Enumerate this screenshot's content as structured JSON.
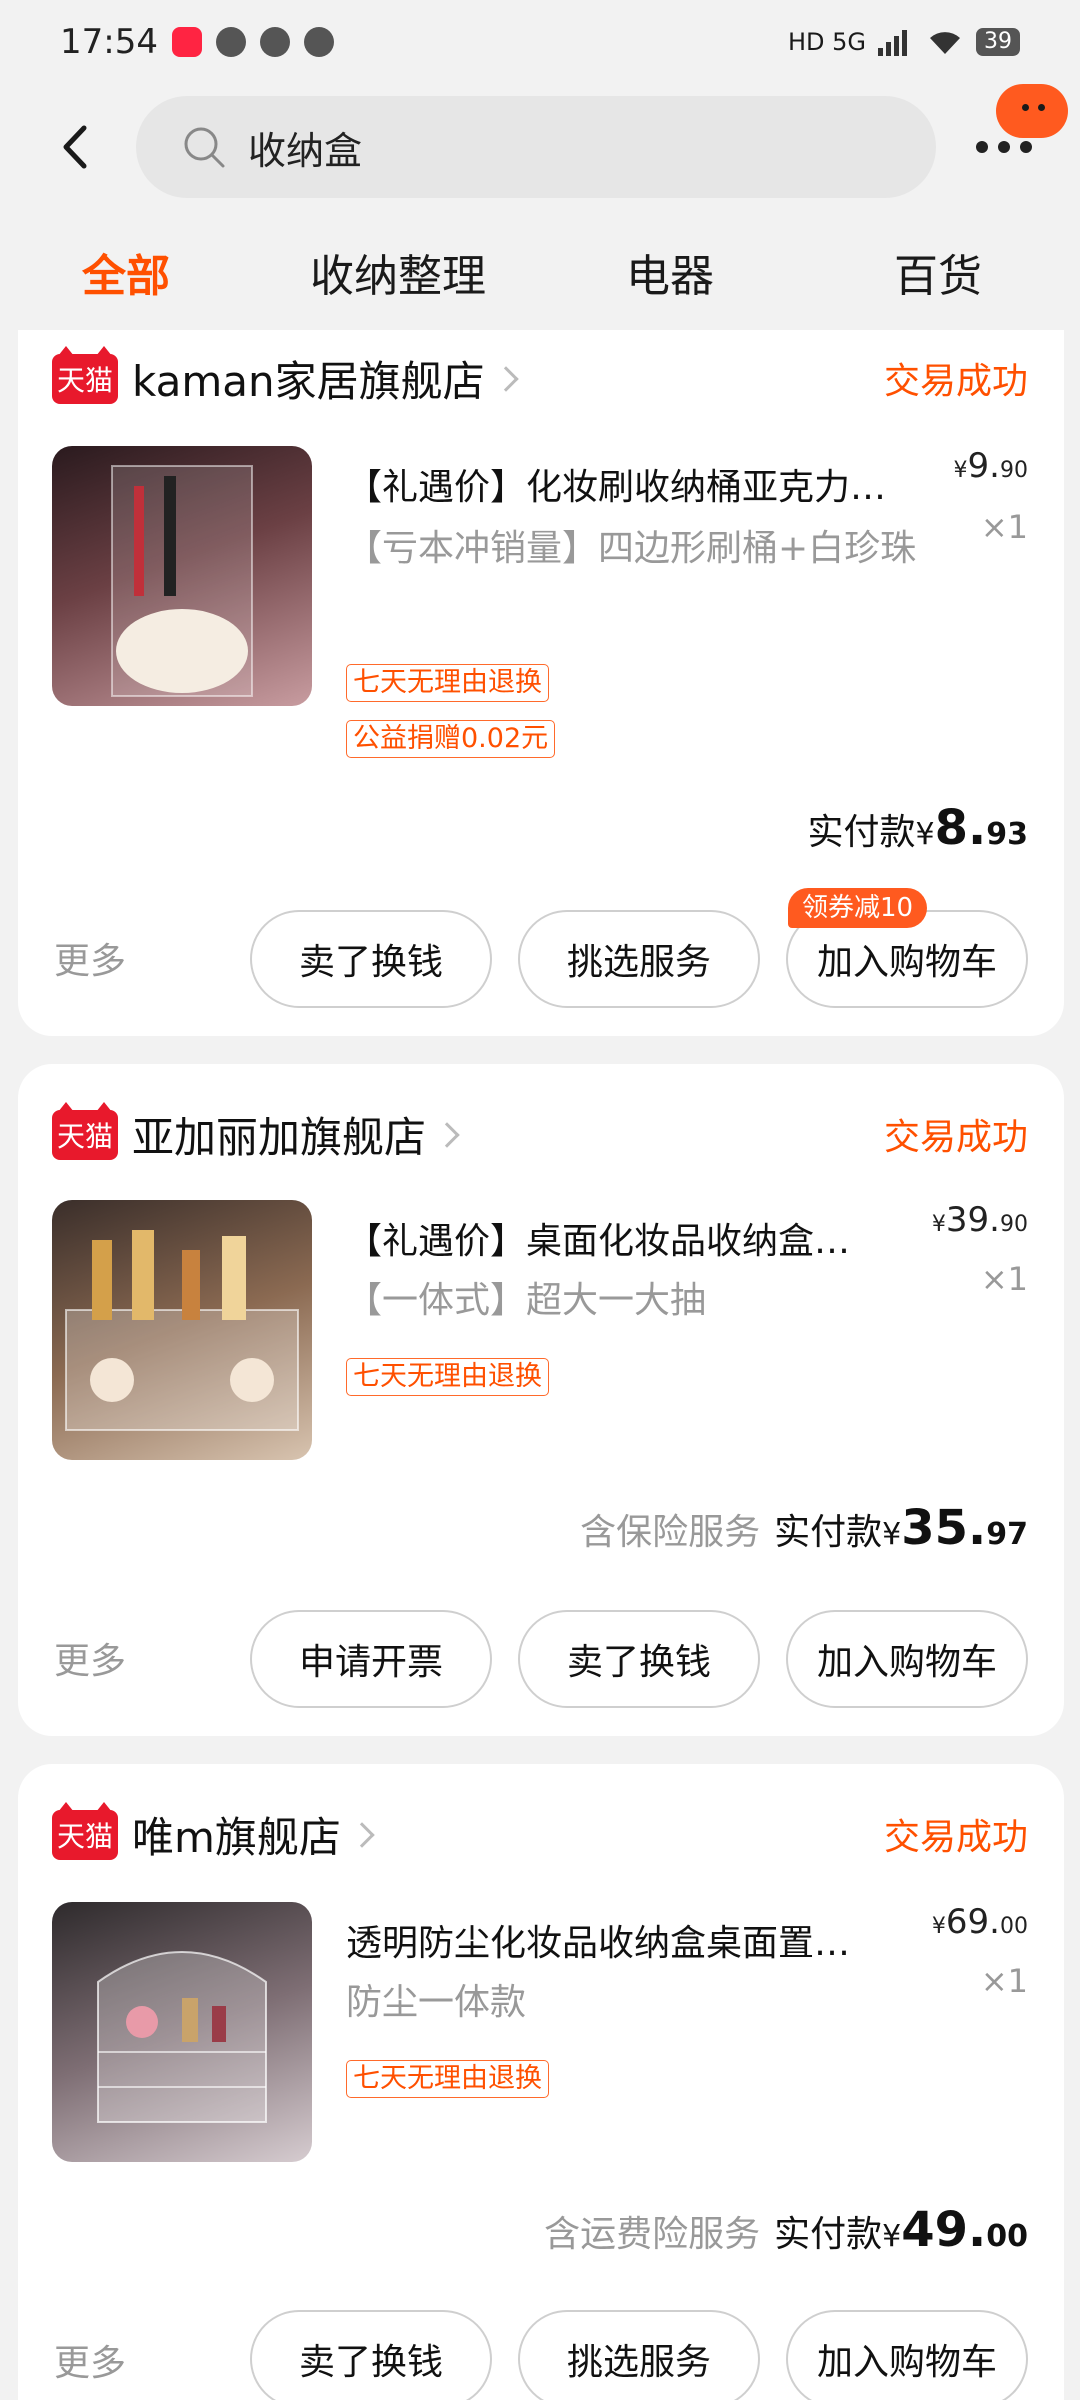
{
  "status_bar": {
    "time": "17:54",
    "network": "HD 5G",
    "battery": "39"
  },
  "search": {
    "query": "收纳盒"
  },
  "tabs": [
    "全部",
    "收纳整理",
    "电器",
    "百货"
  ],
  "orders": [
    {
      "shop_badge": "天猫",
      "shop_name": "kaman家居旗舰店",
      "status": "交易成功",
      "title": "【礼遇价】化妆刷收纳桶亚克力…",
      "sku": "【亏本冲销量】四边形刷桶+白珍珠",
      "price_int": "9.",
      "price_dec": "90",
      "currency": "¥",
      "qty": "×1",
      "tags": [
        "七天无理由退换",
        "公益捐赠0.02元"
      ],
      "service": "",
      "paid_label": "实付款",
      "paid_int": "8.",
      "paid_dec": "93",
      "more": "更多",
      "buttons": [
        "卖了换钱",
        "挑选服务",
        "加入购物车"
      ],
      "coupon": "领券减10"
    },
    {
      "shop_badge": "天猫",
      "shop_name": "亚加丽加旗舰店",
      "status": "交易成功",
      "title": "【礼遇价】桌面化妆品收纳盒…",
      "sku": "【一体式】超大一大抽",
      "price_int": "39.",
      "price_dec": "90",
      "currency": "¥",
      "qty": "×1",
      "tags": [
        "七天无理由退换"
      ],
      "service": "含保险服务",
      "paid_label": "实付款",
      "paid_int": "35.",
      "paid_dec": "97",
      "more": "更多",
      "buttons": [
        "申请开票",
        "卖了换钱",
        "加入购物车"
      ]
    },
    {
      "shop_badge": "天猫",
      "shop_name": "唯m旗舰店",
      "status": "交易成功",
      "title": "透明防尘化妆品收纳盒桌面置…",
      "sku": "防尘一体款",
      "price_int": "69.",
      "price_dec": "00",
      "currency": "¥",
      "qty": "×1",
      "tags": [
        "七天无理由退换"
      ],
      "service": "含运费险服务",
      "paid_label": "实付款",
      "paid_int": "49.",
      "paid_dec": "00",
      "more": "更多",
      "buttons": [
        "卖了换钱",
        "挑选服务",
        "加入购物车"
      ]
    }
  ],
  "colors": {
    "accent": "#ff5000",
    "tmall": "#e8192c",
    "background": "#f2f2f2"
  }
}
